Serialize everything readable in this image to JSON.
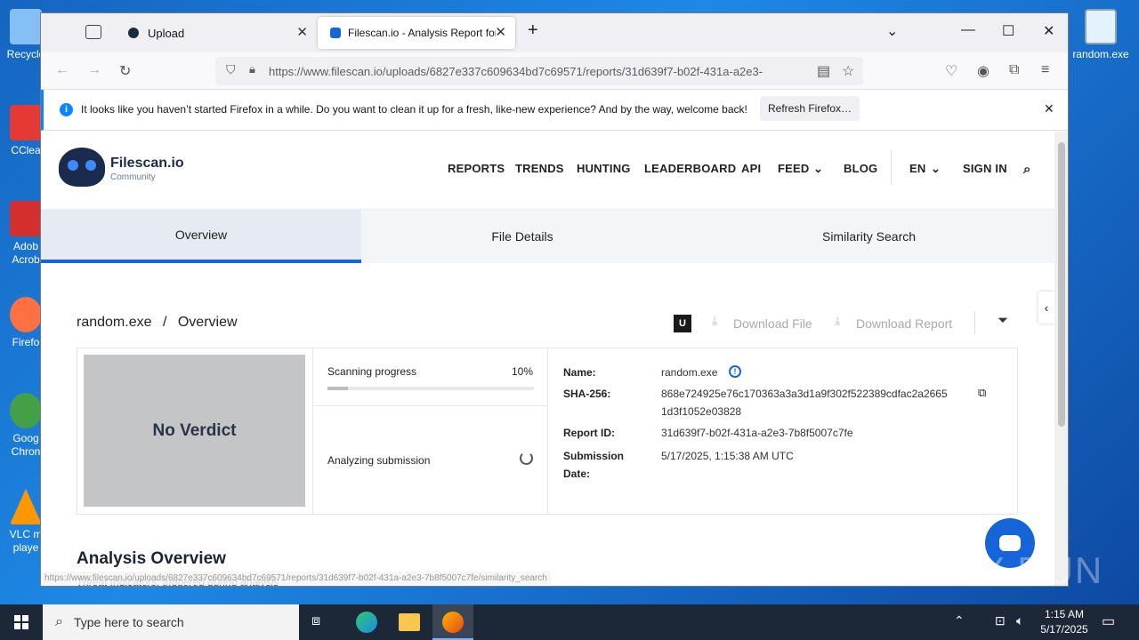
{
  "desktop": {
    "icons_left": [
      "Recycle",
      "CClea",
      "Adob Acrob",
      "Firefo",
      "Goog Chron",
      "VLC m playe"
    ],
    "icon_right": "random.exe"
  },
  "browser": {
    "tabs": [
      {
        "label": "Upload"
      },
      {
        "label": "Filescan.io - Analysis Report for"
      }
    ],
    "url": "https://www.filescan.io/uploads/6827e337c609634bd7c69571/reports/31d639f7-b02f-431a-a2e3-",
    "notice": {
      "text": "It looks like you haven’t started Firefox in a while. Do you want to clean it up for a fresh, like-new experience? And by the way, welcome back!",
      "button": "Refresh Firefox…"
    },
    "status_url": "https://www.filescan.io/uploads/6827e337c609634bd7c69571/reports/31d639f7-b02f-431a-a2e3-7b8f5007c7fe/similarity_search"
  },
  "site": {
    "logo": {
      "name": "Filescan.io",
      "sub": "Community"
    },
    "menu": [
      "REPORTS",
      "TRENDS",
      "HUNTING",
      "LEADERBOARD",
      "API",
      "FEED",
      "BLOG",
      "EN",
      "SIGN IN"
    ],
    "tabs": [
      "Overview",
      "File Details",
      "Similarity Search"
    ],
    "breadcrumb": {
      "file": "random.exe",
      "sep": "/",
      "page": "Overview"
    },
    "badge": "U",
    "download_file": "Download File",
    "download_report": "Download Report",
    "verdict": "No Verdict",
    "scan": {
      "label": "Scanning progress",
      "percent_text": "10%",
      "progress": 0.1,
      "analyzing": "Analyzing submission"
    },
    "details": {
      "name_label": "Name:",
      "name": "random.exe",
      "sha_label": "SHA-256:",
      "sha_line1": "868e724925e76c170363a3a3d1a9f302f522389cdfac2a2665",
      "sha_line2": "1d3f1052e03828",
      "report_label": "Report ID:",
      "report_id": "31d639f7-b02f-431a-a2e3-7b8f5007c7fe",
      "date_label_1": "Submission",
      "date_label_2": "Date:",
      "date": "5/17/2025, 1:15:38 AM UTC"
    },
    "analysis_title": "Analysis Overview",
    "analysis_sub": "Threat Indicators, triggered during analysis"
  },
  "taskbar": {
    "search_placeholder": "Type here to search",
    "time": "1:15 AM",
    "date": "5/17/2025"
  },
  "watermark": "ANY RUN",
  "colors": {
    "accent": "#1565d8",
    "verdict_bg": "#c4c5c7",
    "notice_border": "#0a84ff"
  }
}
